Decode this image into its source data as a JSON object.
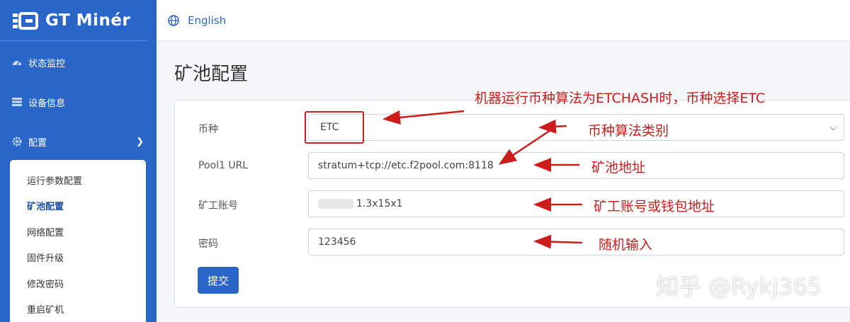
{
  "brand": {
    "name": "GT Minér"
  },
  "sidebar": {
    "items": [
      {
        "label": "状态监控",
        "icon": "dashboard-icon"
      },
      {
        "label": "设备信息",
        "icon": "device-list-icon"
      },
      {
        "label": "配置",
        "icon": "gear-icon"
      }
    ],
    "submenu": [
      {
        "label": "运行参数配置"
      },
      {
        "label": "矿池配置",
        "active": true
      },
      {
        "label": "网络配置"
      },
      {
        "label": "固件升级"
      },
      {
        "label": "修改密码"
      },
      {
        "label": "重启矿机"
      }
    ]
  },
  "topbar": {
    "language": "English",
    "language_icon": "globe-icon"
  },
  "page": {
    "title": "矿池配置"
  },
  "form": {
    "coin": {
      "label": "币种",
      "value": "ETC"
    },
    "pool1_url": {
      "label": "Pool1 URL",
      "value": "stratum+tcp://etc.f2pool.com:8118"
    },
    "worker": {
      "label": "矿工账号",
      "value": "1.3x15x1"
    },
    "password": {
      "label": "密码",
      "value": "123456"
    },
    "submit_label": "提交"
  },
  "annotations": {
    "note_coin": "机器运行币种算法为ETCHASH时，币种选择ETC",
    "note_algo": "币种算法类别",
    "note_pool": "矿池地址",
    "note_worker": "矿工账号或钱包地址",
    "note_password": "随机输入"
  },
  "watermark": "知乎 @Rykj365",
  "colors": {
    "sidebar": "#2a66c8",
    "accent": "#2a66c8",
    "annotation": "#cc1c1c"
  }
}
